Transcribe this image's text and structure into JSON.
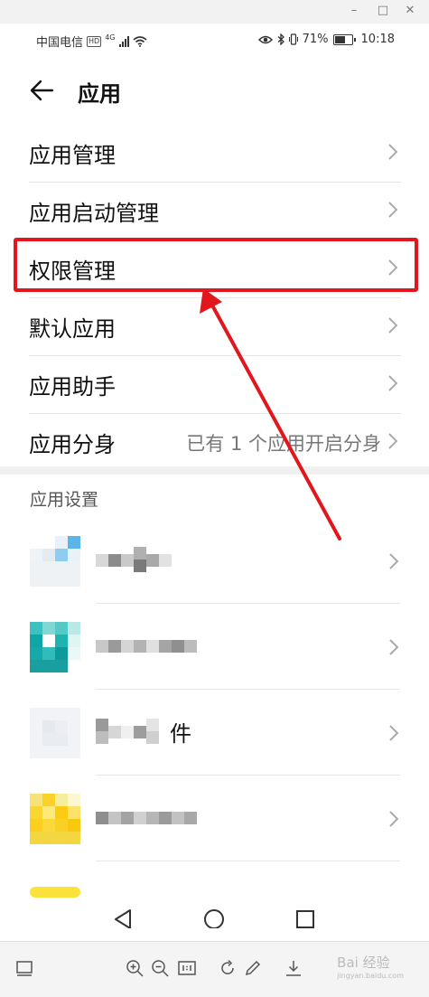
{
  "status_bar": {
    "carrier": "中国电信",
    "hd": "HD",
    "network": "4G",
    "battery": "71%",
    "battery_level": 0.71,
    "time": "10:18"
  },
  "header": {
    "title": "应用"
  },
  "menu": [
    {
      "label": "应用管理",
      "sub": ""
    },
    {
      "label": "应用启动管理",
      "sub": ""
    },
    {
      "label": "权限管理",
      "sub": ""
    },
    {
      "label": "默认应用",
      "sub": ""
    },
    {
      "label": "应用助手",
      "sub": ""
    },
    {
      "label": "应用分身",
      "sub": "已有 1 个应用开启分身"
    }
  ],
  "section_title": "应用设置",
  "apps": [
    {
      "visible_text": ""
    },
    {
      "visible_text": ""
    },
    {
      "visible_text": "件"
    },
    {
      "visible_text": ""
    }
  ],
  "highlight_target": "权限管理",
  "colors": {
    "annotation": "#e2161d",
    "background": "#ffffff",
    "text": "#111111",
    "secondary": "#777777"
  },
  "watermark": {
    "text": "Bai 经验",
    "sub": "jingyan.baidu.com"
  }
}
